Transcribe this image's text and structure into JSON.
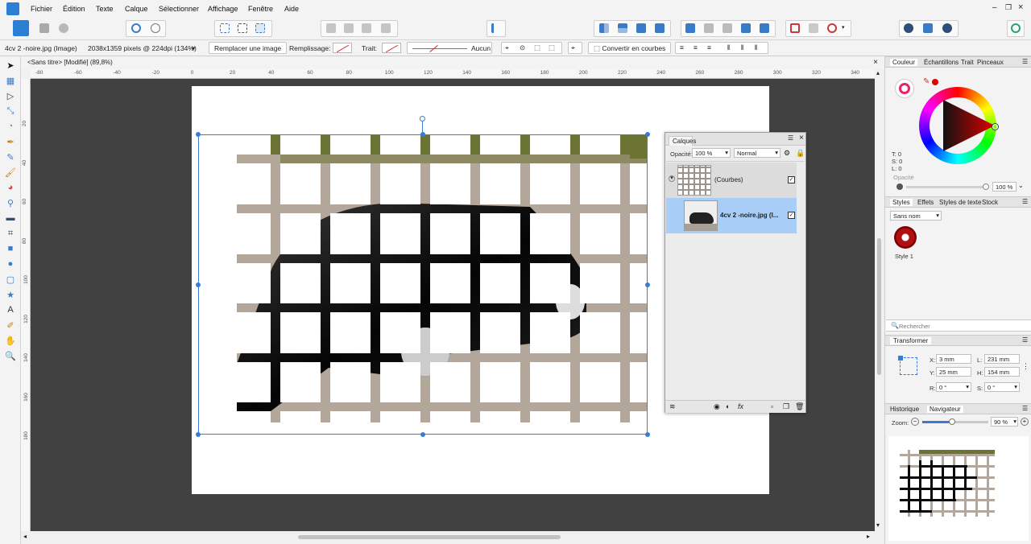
{
  "menu": [
    "Fichier",
    "Édition",
    "Texte",
    "Calque",
    "Sélectionner",
    "Affichage",
    "Fenêtre",
    "Aide"
  ],
  "context": {
    "layer_name": "4cv 2 -noire.jpg (Image)",
    "size_info": "2038x1359 pixels @ 224dpi (134%)",
    "replace_button": "Remplacer une image",
    "fill_label": "Remplissage:",
    "stroke_label": "Trait:",
    "stroke_style": "Aucun",
    "convert_button": "Convertir en courbes"
  },
  "document": {
    "tab_title": "<Sans titre> [Modifié] (89,8%)",
    "close": "×"
  },
  "rulers": {
    "h_ticks": [
      "-80",
      "-60",
      "-40",
      "-20",
      "0",
      "20",
      "40",
      "60",
      "80",
      "100",
      "120",
      "140",
      "160",
      "180",
      "200",
      "220",
      "240",
      "260",
      "280",
      "300",
      "320",
      "340"
    ],
    "v_ticks": [
      "20",
      "40",
      "60",
      "80",
      "100",
      "120",
      "140",
      "160",
      "180"
    ]
  },
  "layers_panel": {
    "title": "Calques",
    "opacity_label": "Opacité:",
    "opacity_value": "100 %",
    "blend_mode": "Normal",
    "layers": [
      {
        "name": "(Courbes)",
        "visible": true,
        "selected": false
      },
      {
        "name": "4cv 2 -noire.jpg (I...",
        "visible": true,
        "selected": true
      }
    ],
    "fx_label": "fx"
  },
  "color_panel": {
    "tabs": [
      "Couleur",
      "Échantillons",
      "Trait",
      "Pinceaux"
    ],
    "t_label": "T: 0",
    "s_label": "S: 0",
    "l_label": "L: 0",
    "opacity_label": "Opacité",
    "opacity_value": "100 %",
    "primary_color": "#e00000"
  },
  "styles_panel": {
    "tabs": [
      "Styles",
      "Effets",
      "Styles de texte",
      "Stock"
    ],
    "category": "Sans nom",
    "style_name": "Style 1"
  },
  "search": {
    "placeholder": "Rechercher"
  },
  "transform_panel": {
    "title": "Transformer",
    "x_label": "X:",
    "x_value": "3 mm",
    "y_label": "Y:",
    "y_value": "25 mm",
    "w_label": "L:",
    "w_value": "231 mm",
    "h_label": "H:",
    "h_value": "154 mm",
    "r_label": "R:",
    "r_value": "0 °",
    "s_label": "S:",
    "s_value": "0 °"
  },
  "navigator_panel": {
    "tabs": [
      "Historique",
      "Navigateur"
    ],
    "zoom_label": "Zoom:",
    "zoom_value": "90 %",
    "zoom_fraction": 0.45
  },
  "colors": {
    "accent": "#2a7fd4",
    "grid_beige": "#b3a79c",
    "grid_green": "#6c7434",
    "selection": "#3a7bd5",
    "canvas_bg": "#414141"
  }
}
